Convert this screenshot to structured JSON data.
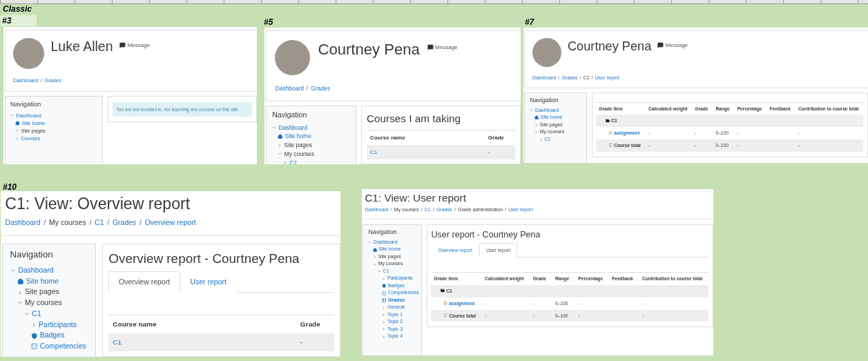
{
  "sheet": {
    "title": "Classic"
  },
  "shots": [
    {
      "label": "#3",
      "header": {
        "kind": "profile",
        "name": "Luke Allen",
        "message": "Message",
        "breadcrumb": {
          "separator": "/",
          "items": [
            {
              "text": "Dashboard",
              "link": true
            },
            {
              "text": "Grades",
              "link": true
            }
          ]
        }
      },
      "nav": {
        "title": "Navigation",
        "items": [
          {
            "text": "Dashboard",
            "kind": "branch",
            "link": true,
            "expanded": true,
            "current": false,
            "children": [
              {
                "text": "Site home",
                "kind": "home",
                "link": true,
                "current": false
              },
              {
                "text": "Site pages",
                "kind": "branch",
                "link": false,
                "expanded": false,
                "current": false
              },
              {
                "text": "Courses",
                "kind": "branch",
                "link": true,
                "expanded": false,
                "current": false
              }
            ]
          }
        ]
      },
      "main": {
        "alert": "You are not enrolled in, nor teaching any courses on this site."
      }
    },
    {
      "label": "#5",
      "header": {
        "kind": "profile",
        "name": "Courtney Pena",
        "message": "Message",
        "breadcrumb": {
          "separator": "/",
          "items": [
            {
              "text": "Dashboard",
              "link": true
            },
            {
              "text": "Grades",
              "link": true
            }
          ]
        }
      },
      "nav": {
        "title": "Navigation",
        "items": [
          {
            "text": "Dashboard",
            "kind": "branch",
            "link": true,
            "expanded": true,
            "current": false,
            "children": [
              {
                "text": "Site home",
                "kind": "home",
                "link": true,
                "current": false
              },
              {
                "text": "Site pages",
                "kind": "branch",
                "link": false,
                "expanded": false,
                "current": false
              },
              {
                "text": "My courses",
                "kind": "branch",
                "link": false,
                "expanded": true,
                "current": false,
                "children": [
                  {
                    "text": "C1",
                    "kind": "branch",
                    "link": true,
                    "expanded": false,
                    "current": false
                  }
                ]
              }
            ]
          }
        ]
      },
      "main": {
        "heading": "Courses I am taking",
        "table": {
          "kind": "courses",
          "columns": [
            "Course name",
            "Grade"
          ],
          "rows": [
            {
              "course": "C1",
              "grade": "-"
            }
          ]
        }
      }
    },
    {
      "label": "#7",
      "header": {
        "kind": "profile",
        "name": "Courtney Pena",
        "message": "Message",
        "breadcrumb": {
          "separator": "/",
          "items": [
            {
              "text": "Dashboard",
              "link": true
            },
            {
              "text": "Grades",
              "link": true
            },
            {
              "text": "C1",
              "link": false
            },
            {
              "text": "User report",
              "link": true
            }
          ]
        }
      },
      "nav": {
        "title": "Navigation",
        "items": [
          {
            "text": "Dashboard",
            "kind": "branch",
            "link": true,
            "expanded": true,
            "current": false,
            "children": [
              {
                "text": "Site home",
                "kind": "home",
                "link": true,
                "current": false
              },
              {
                "text": "Site pages",
                "kind": "branch",
                "link": false,
                "expanded": false,
                "current": false
              },
              {
                "text": "My courses",
                "kind": "branch",
                "link": false,
                "expanded": true,
                "current": false,
                "children": [
                  {
                    "text": "C1",
                    "kind": "branch",
                    "link": true,
                    "expanded": false,
                    "current": false
                  }
                ]
              }
            ]
          }
        ]
      },
      "main": {
        "table": {
          "kind": "grades",
          "columns": [
            "Grade item",
            "Calculated weight",
            "Grade",
            "Range",
            "Percentage",
            "Feedback",
            "Contribution to course total"
          ],
          "rows": [
            {
              "kind": "category",
              "name": "C1"
            },
            {
              "kind": "item",
              "name": "assignment",
              "weight": "-",
              "grade": "-",
              "range": "0–100",
              "percentage": "-",
              "contribution": "-"
            },
            {
              "kind": "total",
              "name": "Course total",
              "weight": "-",
              "grade": "-",
              "range": "0–100",
              "percentage": "-",
              "contribution": "-"
            }
          ]
        }
      }
    },
    {
      "label": "#10",
      "header": {
        "kind": "page",
        "title": "C1: View: Overview report",
        "breadcrumb": {
          "separator": "/",
          "items": [
            {
              "text": "Dashboard",
              "link": true
            },
            {
              "text": "My courses",
              "link": false
            },
            {
              "text": "C1",
              "link": true
            },
            {
              "text": "Grades",
              "link": true
            },
            {
              "text": "Overview report",
              "link": true
            }
          ]
        }
      },
      "nav": {
        "title": "Navigation",
        "items": [
          {
            "text": "Dashboard",
            "kind": "branch",
            "link": true,
            "expanded": true,
            "current": false,
            "children": [
              {
                "text": "Site home",
                "kind": "home",
                "link": true,
                "current": false
              },
              {
                "text": "Site pages",
                "kind": "branch",
                "link": false,
                "expanded": false,
                "current": false
              },
              {
                "text": "My courses",
                "kind": "branch",
                "link": false,
                "expanded": true,
                "current": false,
                "children": [
                  {
                    "text": "C1",
                    "kind": "branch",
                    "link": true,
                    "expanded": true,
                    "current": false,
                    "children": [
                      {
                        "text": "Participants",
                        "kind": "branch",
                        "link": true,
                        "expanded": false,
                        "current": false
                      },
                      {
                        "text": "Badges",
                        "kind": "badge",
                        "link": true,
                        "current": false
                      },
                      {
                        "text": "Competencies",
                        "kind": "check",
                        "link": true,
                        "current": false
                      }
                    ]
                  }
                ]
              }
            ]
          }
        ]
      },
      "main": {
        "heading": "Overview report - Courtney Pena",
        "tabs": [
          {
            "label": "Overview report",
            "selected": true
          },
          {
            "label": "User report",
            "selected": false
          }
        ],
        "table": {
          "kind": "courses",
          "columns": [
            "Course name",
            "Grade"
          ],
          "rows": [
            {
              "course": "C1",
              "grade": "-"
            }
          ]
        }
      }
    },
    {
      "header": {
        "kind": "page",
        "title": "C1: View: User report",
        "breadcrumb": {
          "separator": "/",
          "items": [
            {
              "text": "Dashboard",
              "link": true
            },
            {
              "text": "My courses",
              "link": false
            },
            {
              "text": "C1",
              "link": true
            },
            {
              "text": "Grades",
              "link": true
            },
            {
              "text": "Grade administration",
              "link": false
            },
            {
              "text": "User report",
              "link": true
            }
          ]
        }
      },
      "nav": {
        "title": "Navigation",
        "items": [
          {
            "text": "Dashboard",
            "kind": "branch",
            "link": true,
            "expanded": true,
            "current": false,
            "children": [
              {
                "text": "Site home",
                "kind": "home",
                "link": true,
                "current": false
              },
              {
                "text": "Site pages",
                "kind": "branch",
                "link": false,
                "expanded": false,
                "current": false
              },
              {
                "text": "My courses",
                "kind": "branch",
                "link": false,
                "expanded": true,
                "current": false,
                "children": [
                  {
                    "text": "C1",
                    "kind": "branch",
                    "link": true,
                    "expanded": true,
                    "current": false,
                    "children": [
                      {
                        "text": "Participants",
                        "kind": "branch",
                        "link": true,
                        "expanded": false,
                        "current": false
                      },
                      {
                        "text": "Badges",
                        "kind": "badge",
                        "link": true,
                        "current": false
                      },
                      {
                        "text": "Competencies",
                        "kind": "check",
                        "link": true,
                        "current": false
                      },
                      {
                        "text": "Grades",
                        "kind": "grid",
                        "link": true,
                        "current": true
                      },
                      {
                        "text": "General",
                        "kind": "branch",
                        "link": true,
                        "expanded": false,
                        "current": false
                      },
                      {
                        "text": "Topic 1",
                        "kind": "branch",
                        "link": true,
                        "expanded": false,
                        "current": false
                      },
                      {
                        "text": "Topic 2",
                        "kind": "branch",
                        "link": true,
                        "expanded": false,
                        "current": false
                      },
                      {
                        "text": "Topic 3",
                        "kind": "branch",
                        "link": true,
                        "expanded": false,
                        "current": false
                      },
                      {
                        "text": "Topic 4",
                        "kind": "branch",
                        "link": true,
                        "expanded": false,
                        "current": false
                      }
                    ]
                  }
                ]
              }
            ]
          }
        ]
      },
      "main": {
        "heading": "User report - Courtney Pena",
        "tabs": [
          {
            "label": "Overview report",
            "selected": false
          },
          {
            "label": "User report",
            "selected": true
          }
        ],
        "table": {
          "kind": "grades",
          "columns": [
            "Grade item",
            "Calculated weight",
            "Grade",
            "Range",
            "Percentage",
            "Feedback",
            "Contribution to course total"
          ],
          "rows": [
            {
              "kind": "category",
              "name": "C1"
            },
            {
              "kind": "item",
              "name": "assignment",
              "weight": "-",
              "grade": "-",
              "range": "0–100",
              "percentage": "-",
              "contribution": "-"
            },
            {
              "kind": "total",
              "name": "Course total",
              "weight": "-",
              "grade": "-",
              "range": "0–100",
              "percentage": "-",
              "contribution": "-"
            }
          ]
        }
      }
    }
  ]
}
